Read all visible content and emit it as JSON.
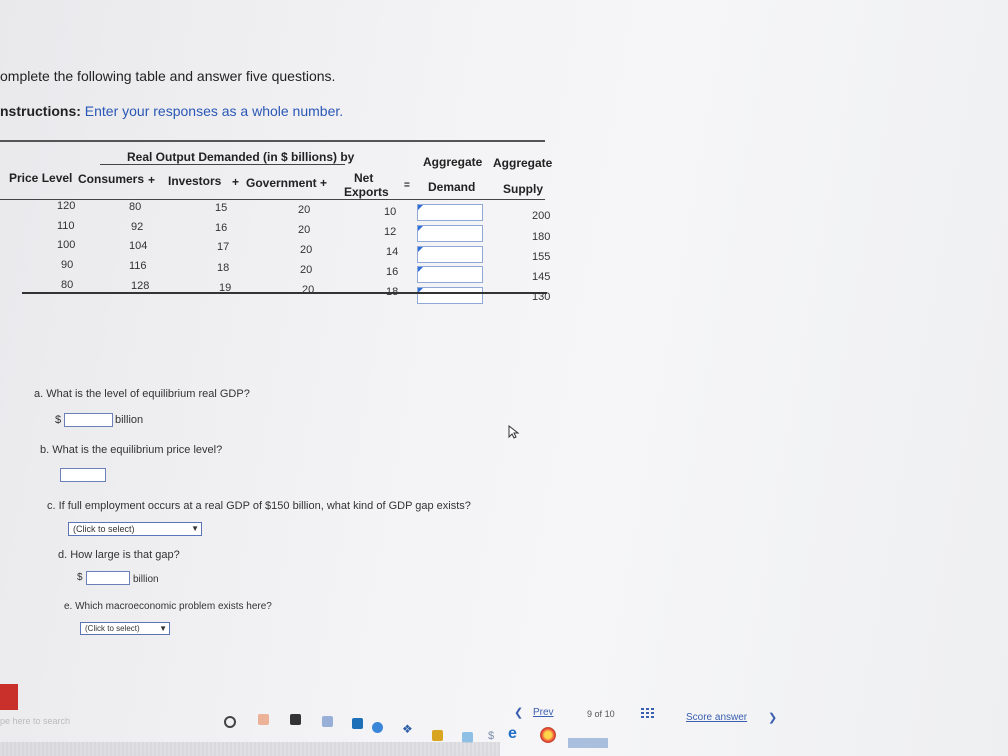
{
  "page": {
    "heading": "omplete the following table and answer five questions.",
    "instructions_label": "nstructions:",
    "instructions_text": "Enter your responses as a whole number."
  },
  "table": {
    "group_header": "Real Output Demanded (in $ billions) by",
    "headers": {
      "price_level": "Price Level",
      "consumers": "Consumers",
      "plus1": "+",
      "investors": "Investors",
      "plus2": "+",
      "government": "Government +",
      "net": "Net",
      "exports": "Exports",
      "equals": "=",
      "agg1": "Aggregate",
      "demand": "Demand",
      "agg2": "Aggregate",
      "supply": "Supply"
    },
    "rows": [
      {
        "price": "120",
        "consumers": "80",
        "investors": "15",
        "government": "20",
        "net_exports": "10",
        "supply": "200"
      },
      {
        "price": "110",
        "consumers": "92",
        "investors": "16",
        "government": "20",
        "net_exports": "12",
        "supply": "180"
      },
      {
        "price": "100",
        "consumers": "104",
        "investors": "17",
        "government": "20",
        "net_exports": "14",
        "supply": "155"
      },
      {
        "price": "90",
        "consumers": "116",
        "investors": "18",
        "government": "20",
        "net_exports": "16",
        "supply": "145"
      },
      {
        "price": "80",
        "consumers": "128",
        "investors": "19",
        "government": "20",
        "net_exports": "18",
        "supply": "130"
      }
    ]
  },
  "questions": {
    "a": {
      "text": "a. What is the level of equilibrium real GDP?",
      "prefix": "$",
      "suffix": "billion"
    },
    "b": {
      "text": "b. What is the equilibrium price level?"
    },
    "c": {
      "text": "c. If full employment occurs at a real GDP of $150 billion, what kind of GDP gap exists?",
      "select": "(Click to select)"
    },
    "d": {
      "text": "d. How large is that gap?",
      "prefix": "$",
      "suffix": "billion"
    },
    "e": {
      "text": "e. Which macroeconomic problem exists here?",
      "select": "(Click to select)"
    }
  },
  "footer": {
    "prev": "Prev",
    "page_current": "9",
    "page_of": "of",
    "page_total": "10",
    "score": "Score answer"
  },
  "taskbar": {
    "search_text": "pe here to search"
  }
}
